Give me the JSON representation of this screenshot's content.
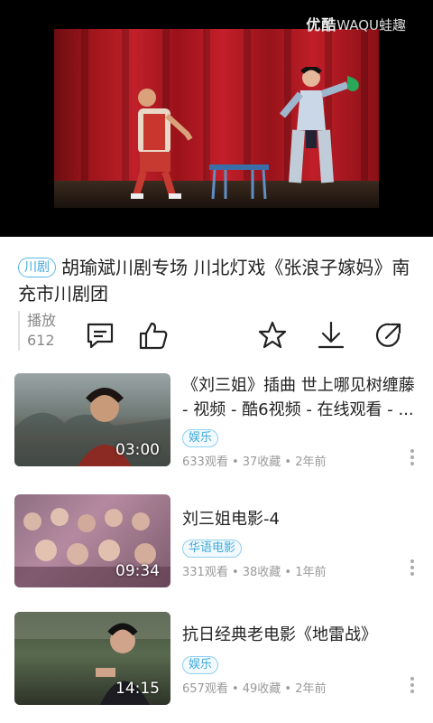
{
  "player": {
    "watermark_brand": "优酷",
    "watermark_app": "WAQU蛙趣"
  },
  "video": {
    "category_tag": "川剧",
    "title": "胡瑜斌川剧专场 川北灯戏《张浪子嫁妈》南充市川剧团",
    "play_label": "播放",
    "play_count": "612"
  },
  "actions": {
    "icons": [
      "comment-icon",
      "like-icon",
      "favorite-star-icon",
      "download-icon",
      "share-icon"
    ]
  },
  "related": [
    {
      "title": "《刘三姐》插曲 世上哪见树缠藤 - 视频 - 酷6视频 - 在线观看 - ...",
      "duration": "03:00",
      "tag": "娱乐",
      "meta": "633观看 • 37收藏 • 2年前"
    },
    {
      "title": "刘三姐电影-4",
      "duration": "09:34",
      "tag": "华语电影",
      "meta": "331观看 • 38收藏 • 1年前"
    },
    {
      "title": "抗日经典老电影《地雷战》",
      "duration": "14:15",
      "tag": "娱乐",
      "meta": "657观看 • 49收藏 • 2年前"
    }
  ],
  "colors": {
    "accent": "#3fa9dd",
    "stage_curtain": "#b01c24"
  }
}
